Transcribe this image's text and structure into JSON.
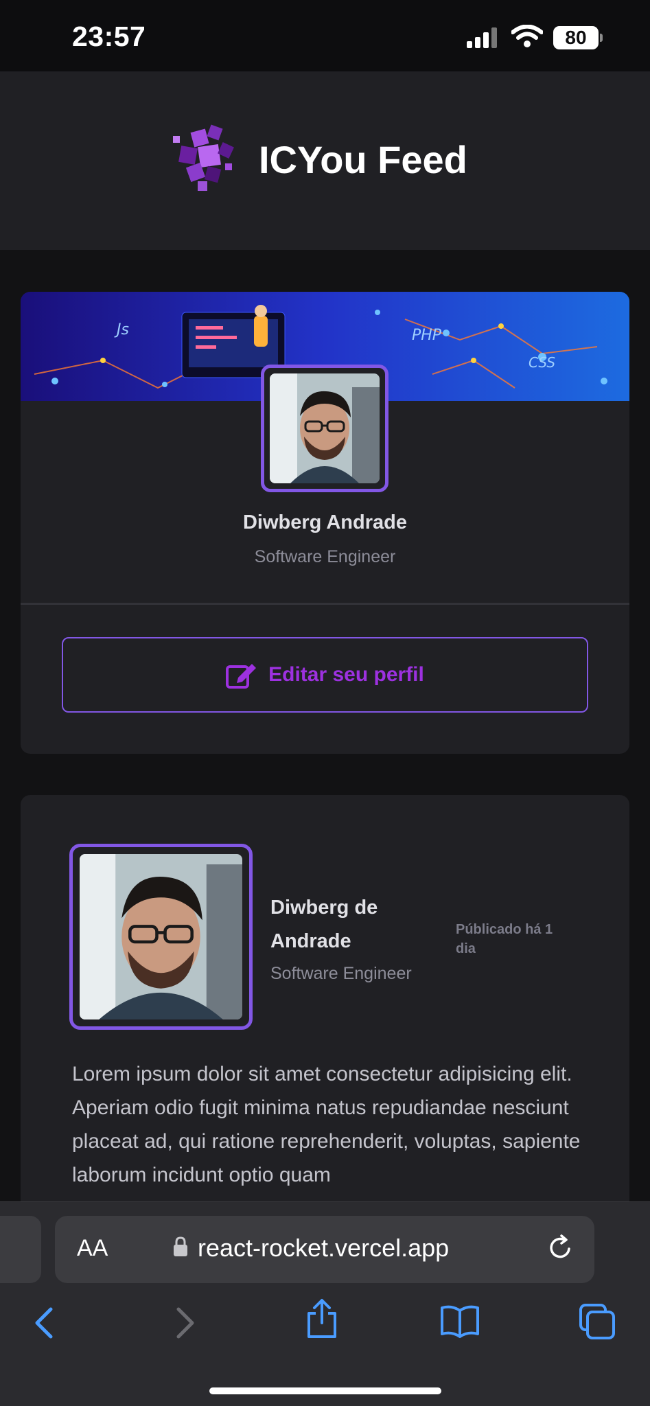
{
  "status_bar": {
    "time": "23:57",
    "battery": "80"
  },
  "header": {
    "title": "ICYou Feed"
  },
  "profile": {
    "name": "Diwberg Andrade",
    "role": "Software Engineer",
    "edit_label": "Editar seu perfil"
  },
  "post": {
    "author_name": "Diwberg de Andrade",
    "author_role": "Software Engineer",
    "published": "Públicado há 1 dia",
    "content": "Lorem ipsum dolor sit amet consectetur adipisicing elit. Aperiam odio fugit minima natus repudiandae nesciunt placeat ad, qui ratione reprehenderit, voluptas, sapiente laborum incidunt optio quam"
  },
  "browser": {
    "aa_label": "AA",
    "url": "react-rocket.vercel.app"
  },
  "colors": {
    "accent": "#8257e5",
    "accent_text": "#9d31e0",
    "card": "#202024",
    "background": "#121214"
  },
  "icons": {
    "logo": "cube-cluster-logo",
    "edit": "pencil-square-icon",
    "lock": "lock-icon",
    "reload": "reload-icon",
    "back": "chevron-left-icon",
    "forward": "chevron-right-icon",
    "share": "share-icon",
    "bookmarks": "book-icon",
    "tabs": "tabs-icon"
  }
}
